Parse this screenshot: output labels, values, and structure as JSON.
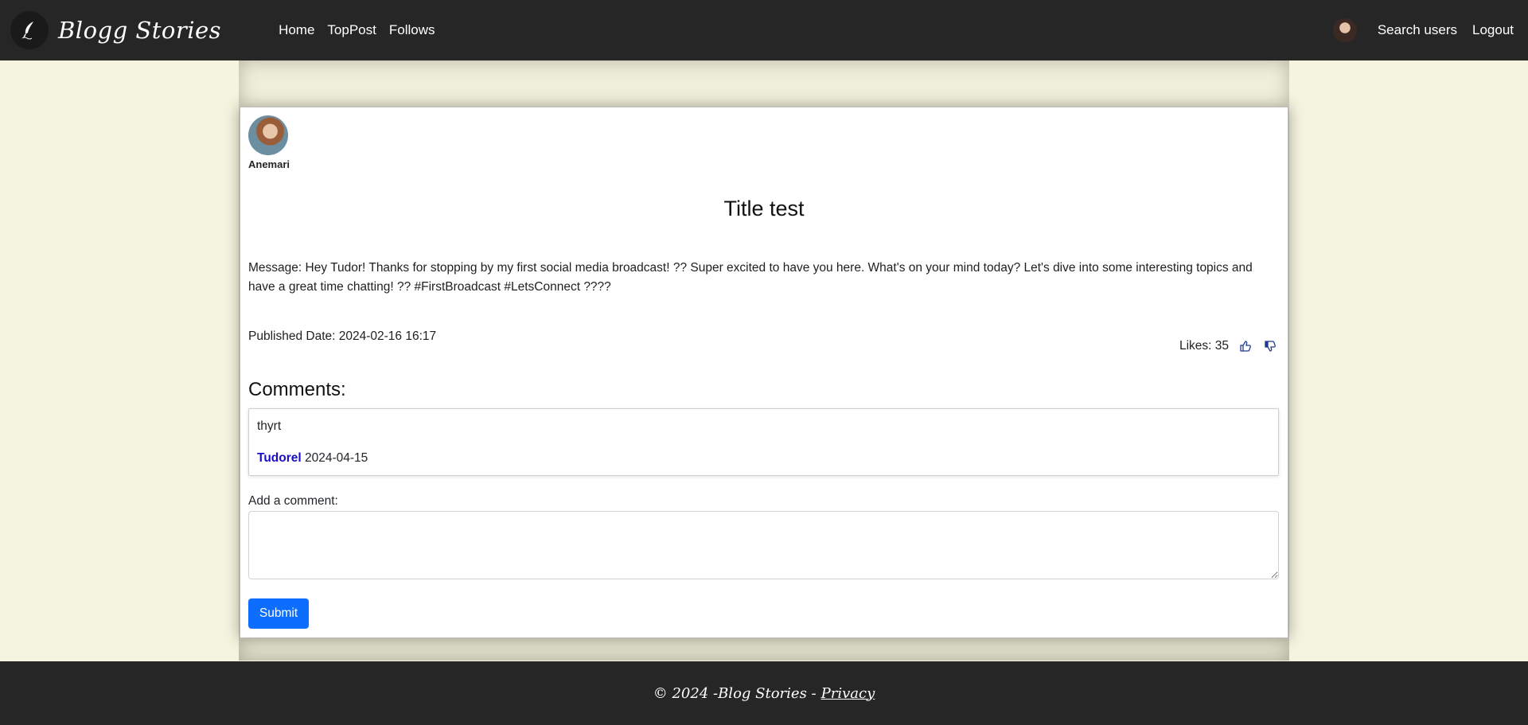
{
  "nav": {
    "brand": "Blogg Stories",
    "links": [
      "Home",
      "TopPost",
      "Follows"
    ],
    "search_users": "Search users",
    "logout": "Logout"
  },
  "post": {
    "author": "Anemari",
    "title": "Title test",
    "message": "Message: Hey Tudor! Thanks for stopping by my first social media broadcast! ?? Super excited to have you here. What's on your mind today? Let's dive into some interesting topics and have a great time chatting! ?? #FirstBroadcast #LetsConnect ????",
    "published": "Published Date: 2024-02-16 16:17",
    "likes": "Likes: 35"
  },
  "comments": {
    "heading": "Comments:",
    "items": [
      {
        "text": "thyrt",
        "author": "Tudorel",
        "date": "2024-04-15"
      }
    ],
    "add_label": "Add a comment:",
    "input_value": "",
    "submit": "Submit"
  },
  "footer": {
    "copyright": "© 2024 -Blog Stories -",
    "privacy": "Privacy"
  },
  "colors": {
    "navbar": "#262626",
    "page_bg": "#f4f4df",
    "primary_button": "#0d6efd",
    "comment_author": "#1a0dcc"
  }
}
